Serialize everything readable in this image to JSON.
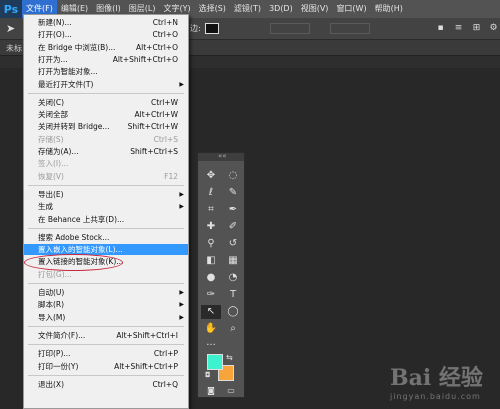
{
  "menubar": {
    "logo": "Ps",
    "items": [
      "文件(F)",
      "编辑(E)",
      "图像(I)",
      "图层(L)",
      "文字(Y)",
      "选择(S)",
      "滤镜(T)",
      "3D(D)",
      "视图(V)",
      "窗口(W)",
      "帮助(H)"
    ]
  },
  "options": {
    "stroke_label": "边:"
  },
  "doctab": {
    "label": "未标"
  },
  "file_menu": {
    "groups": [
      [
        {
          "label": "新建(N)...",
          "shortcut": "Ctrl+N"
        },
        {
          "label": "打开(O)...",
          "shortcut": "Ctrl+O"
        },
        {
          "label": "在 Bridge 中浏览(B)...",
          "shortcut": "Alt+Ctrl+O"
        },
        {
          "label": "打开为...",
          "shortcut": "Alt+Shift+Ctrl+O"
        },
        {
          "label": "打开为智能对象...",
          "shortcut": ""
        },
        {
          "label": "最近打开文件(T)",
          "shortcut": "",
          "submenu": true
        }
      ],
      [
        {
          "label": "关闭(C)",
          "shortcut": "Ctrl+W"
        },
        {
          "label": "关闭全部",
          "shortcut": "Alt+Ctrl+W"
        },
        {
          "label": "关闭并转到 Bridge...",
          "shortcut": "Shift+Ctrl+W"
        },
        {
          "label": "存储(S)",
          "shortcut": "Ctrl+S",
          "disabled": true
        },
        {
          "label": "存储为(A)...",
          "shortcut": "Shift+Ctrl+S"
        },
        {
          "label": "签入(I)...",
          "shortcut": "",
          "disabled": true
        },
        {
          "label": "恢复(V)",
          "shortcut": "F12",
          "disabled": true
        }
      ],
      [
        {
          "label": "导出(E)",
          "shortcut": "",
          "submenu": true
        },
        {
          "label": "生成",
          "shortcut": "",
          "submenu": true
        },
        {
          "label": "在 Behance 上共享(D)...",
          "shortcut": ""
        }
      ],
      [
        {
          "label": "搜索 Adobe Stock...",
          "shortcut": ""
        },
        {
          "label": "置入嵌入的智能对象(L)...",
          "shortcut": "",
          "highlight": true
        },
        {
          "label": "置入链接的智能对象(K)...",
          "shortcut": ""
        },
        {
          "label": "打包(G)...",
          "shortcut": "",
          "disabled": true
        }
      ],
      [
        {
          "label": "自动(U)",
          "shortcut": "",
          "submenu": true
        },
        {
          "label": "脚本(R)",
          "shortcut": "",
          "submenu": true
        },
        {
          "label": "导入(M)",
          "shortcut": "",
          "submenu": true
        }
      ],
      [
        {
          "label": "文件简介(F)...",
          "shortcut": "Alt+Shift+Ctrl+I"
        }
      ],
      [
        {
          "label": "打印(P)...",
          "shortcut": "Ctrl+P"
        },
        {
          "label": "打印一份(Y)",
          "shortcut": "Alt+Shift+Ctrl+P"
        }
      ],
      [
        {
          "label": "退出(X)",
          "shortcut": "Ctrl+Q"
        }
      ]
    ]
  },
  "tools_panel": {
    "tools": [
      "move-tool",
      "marquee-tool",
      "lasso-tool",
      "quick-selection-tool",
      "crop-tool",
      "eyedropper-tool",
      "healing-brush-tool",
      "brush-tool",
      "clone-stamp-tool",
      "history-brush-tool",
      "eraser-tool",
      "gradient-tool",
      "blur-tool",
      "dodge-tool",
      "pen-tool",
      "type-tool",
      "path-selection-tool",
      "shape-tool",
      "hand-tool",
      "zoom-tool",
      "more-tools"
    ],
    "foreground_color": "#3cf2cf",
    "background_color": "#f7a43a"
  },
  "watermark": {
    "logo": "Bai 经验",
    "sub": "jingyan.baidu.com"
  }
}
